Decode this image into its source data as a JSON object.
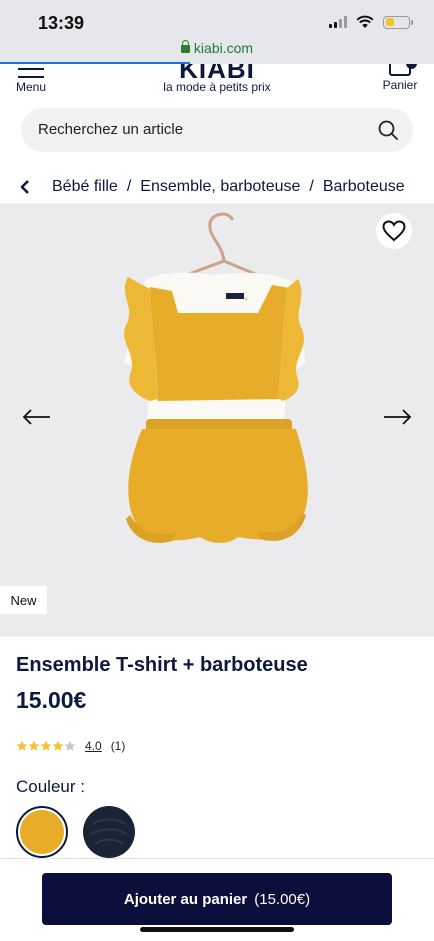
{
  "status_bar": {
    "time": "13:39",
    "url": "kiabi.com",
    "battery_level": 0.38
  },
  "header": {
    "menu_label": "Menu",
    "logo_word": "KIABI",
    "logo_tagline": "la mode à petits prix",
    "cart_label": "Panier"
  },
  "search": {
    "placeholder": "Recherchez un article"
  },
  "breadcrumb": {
    "items": [
      "Bébé fille",
      "Ensemble, barboteuse",
      "Barboteuse"
    ]
  },
  "gallery": {
    "badge": "New"
  },
  "product": {
    "title": "Ensemble T-shirt + barboteuse",
    "price": "15.00€",
    "rating_value": "4.0",
    "rating_count": "(1)",
    "rating": 4,
    "rating_max": 5,
    "color_label": "Couleur :",
    "swatches": [
      {
        "name": "jaune",
        "color": "#e8ad28",
        "selected": true
      },
      {
        "name": "marine",
        "color": "#1b2436",
        "selected": false
      }
    ]
  },
  "cta": {
    "label": "Ajouter au panier",
    "price": "(15.00€)"
  },
  "colors": {
    "brand_navy": "#0b1a3c",
    "button_bg": "#0b0e3a",
    "star_yellow": "#f2c230",
    "url_green": "#1f7a33"
  }
}
